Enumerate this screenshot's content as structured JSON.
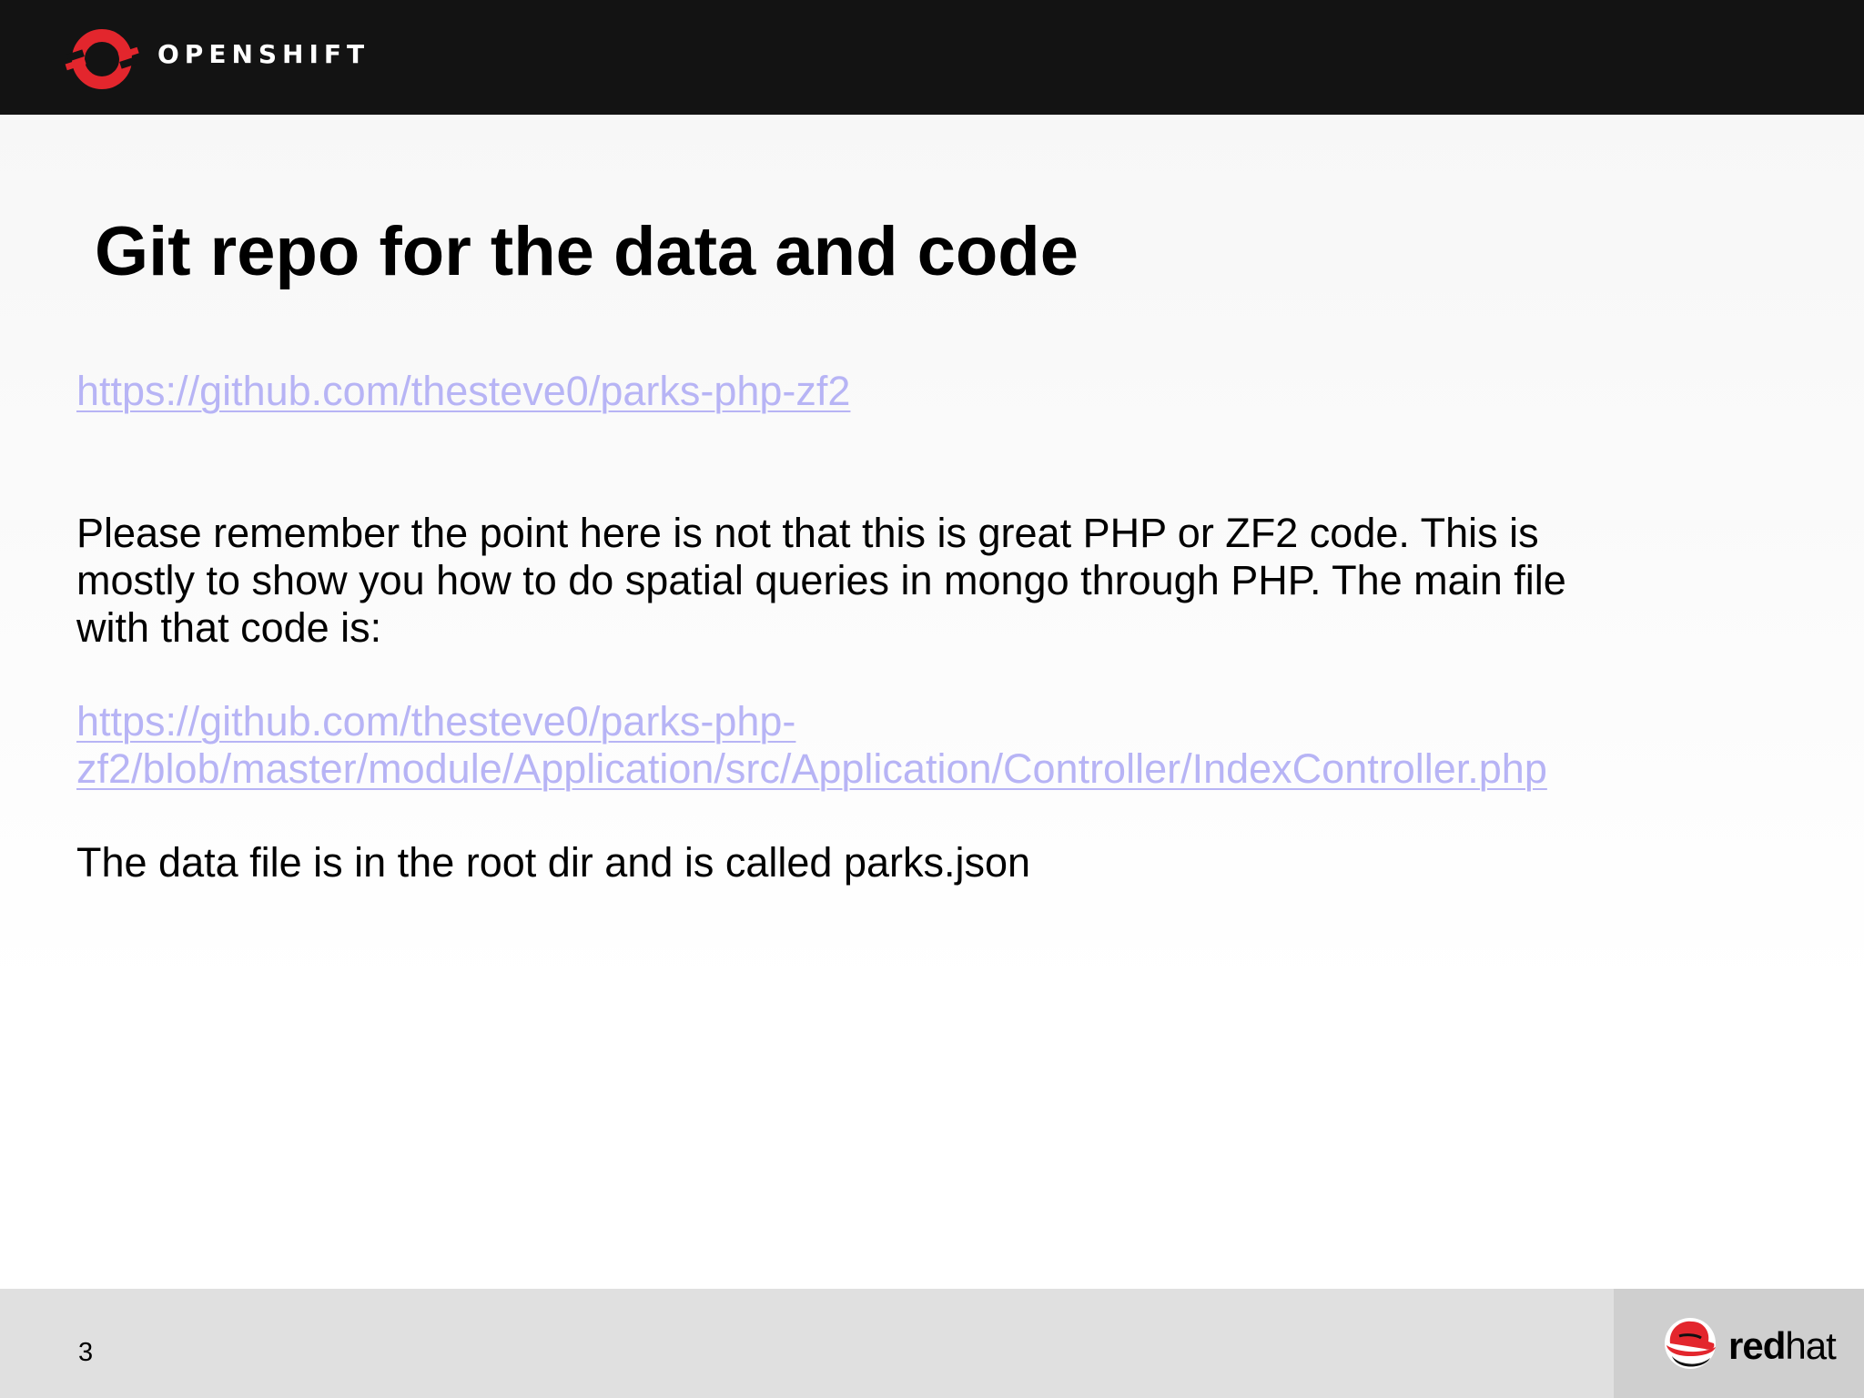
{
  "header": {
    "brand": "OPENSHIFT",
    "logo_icon": "openshift-logo-icon"
  },
  "slide": {
    "title": "Git repo for the data and code",
    "link_1": "https://github.com/thesteve0/parks-php-zf2",
    "paragraph_1": "Please remember the point here is not that this is great PHP or ZF2 code. This is mostly to show you how to do spatial queries in mongo through PHP. The main file with that code is:",
    "link_2_line_1": "https://github.com/thesteve0/parks-php-",
    "link_2_line_2": "zf2/blob/master/module/Application/src/Application/Controller/IndexController.php",
    "paragraph_2": "The data file is in the root dir and is called parks.json"
  },
  "footer": {
    "page_number": "3",
    "brand_bold": "red",
    "brand_light": "hat",
    "logo_icon": "redhat-logo-icon"
  },
  "colors": {
    "header_bg": "#131313",
    "link": "#b7b4f5",
    "brand_red": "#e3262d",
    "footer_bg": "#e0e0e0",
    "footer_logo_bg": "#cfcfcf"
  }
}
